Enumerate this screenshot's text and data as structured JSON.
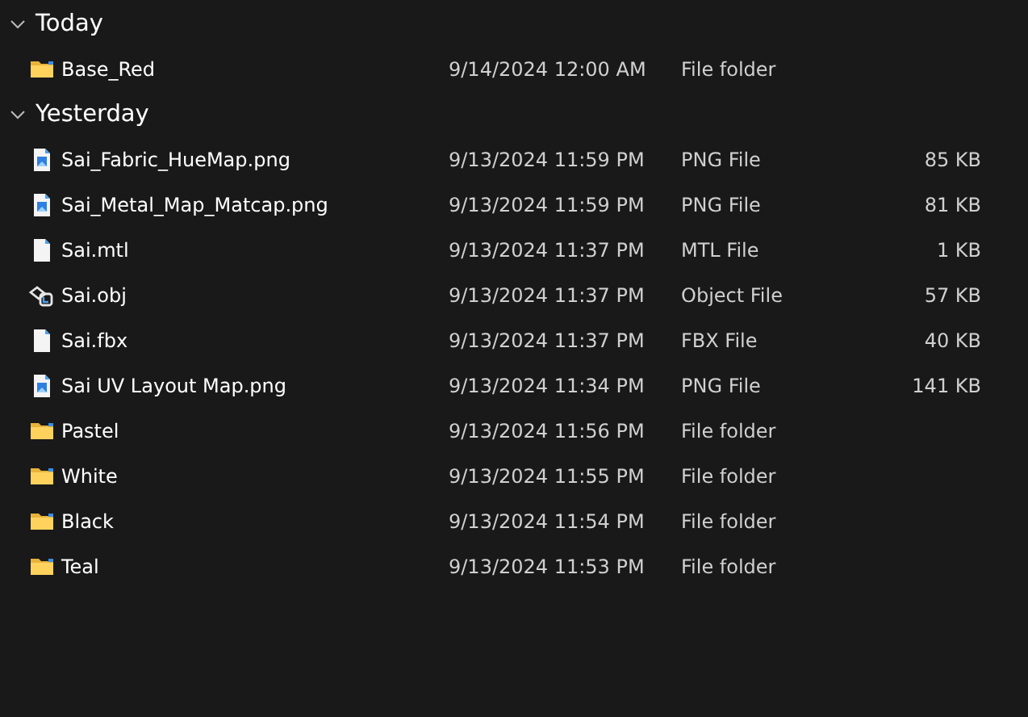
{
  "groups": [
    {
      "label": "Today",
      "expanded": true,
      "items": [
        {
          "name": "Base_Red",
          "kind": "folder",
          "date": "9/14/2024 12:00 AM",
          "type": "File folder"
        }
      ]
    },
    {
      "label": "Yesterday",
      "expanded": true,
      "items": [
        {
          "name": "Sai_Fabric_HueMap.png",
          "kind": "image",
          "date": "9/13/2024 11:59 PM",
          "type": "PNG File",
          "size": "85 KB"
        },
        {
          "name": "Sai_Metal_Map_Matcap.png",
          "kind": "image",
          "date": "9/13/2024 11:59 PM",
          "type": "PNG File",
          "size": "81 KB"
        },
        {
          "name": "Sai.mtl",
          "kind": "file",
          "date": "9/13/2024 11:37 PM",
          "type": "MTL File",
          "size": "1 KB"
        },
        {
          "name": "Sai.obj",
          "kind": "object",
          "date": "9/13/2024 11:37 PM",
          "type": "Object File",
          "size": "57 KB"
        },
        {
          "name": "Sai.fbx",
          "kind": "file",
          "date": "9/13/2024 11:37 PM",
          "type": "FBX File",
          "size": "40 KB"
        },
        {
          "name": "Sai UV Layout Map.png",
          "kind": "image",
          "date": "9/13/2024 11:34 PM",
          "type": "PNG File",
          "size": "141 KB"
        },
        {
          "name": "Pastel",
          "kind": "folder",
          "date": "9/13/2024 11:56 PM",
          "type": "File folder"
        },
        {
          "name": "White",
          "kind": "folder",
          "date": "9/13/2024 11:55 PM",
          "type": "File folder"
        },
        {
          "name": "Black",
          "kind": "folder",
          "date": "9/13/2024 11:54 PM",
          "type": "File folder"
        },
        {
          "name": "Teal",
          "kind": "folder",
          "date": "9/13/2024 11:53 PM",
          "type": "File folder"
        }
      ]
    }
  ]
}
